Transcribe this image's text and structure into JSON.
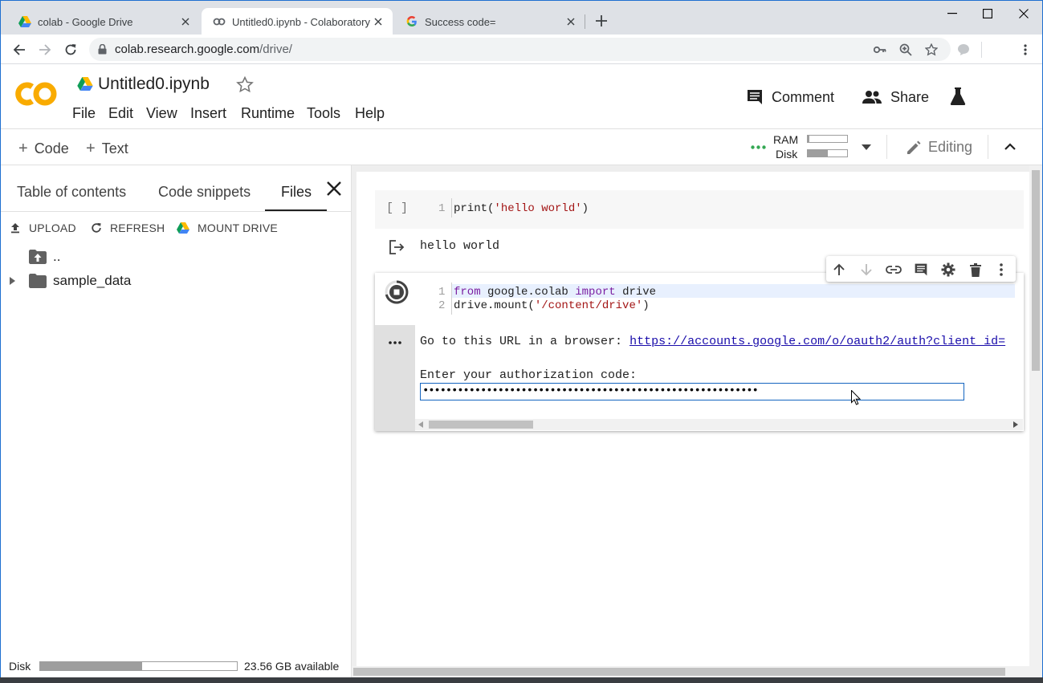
{
  "browser": {
    "tabs": [
      {
        "title": "colab - Google Drive"
      },
      {
        "title": "Untitled0.ipynb - Colaboratory"
      },
      {
        "title": "Success code="
      }
    ],
    "url_host": "colab.research.google.com",
    "url_path": "/drive/"
  },
  "header": {
    "logo_text": "CO",
    "notebook_title": "Untitled0.ipynb",
    "menus": [
      "File",
      "Edit",
      "View",
      "Insert",
      "Runtime",
      "Tools",
      "Help"
    ],
    "comment_label": "Comment",
    "share_label": "Share"
  },
  "toolbar": {
    "code_label": "Code",
    "text_label": "Text",
    "ram_label": "RAM",
    "disk_label": "Disk",
    "ram_fraction": 0.04,
    "disk_fraction": 0.5,
    "editing_label": "Editing"
  },
  "sidepanel": {
    "tabs": [
      "Table of contents",
      "Code snippets",
      "Files"
    ],
    "actions": {
      "upload": "UPLOAD",
      "refresh": "REFRESH",
      "mount": "MOUNT DRIVE"
    },
    "files": [
      "..",
      "sample_data"
    ],
    "disk_label": "Disk",
    "disk_available": "23.56 GB available",
    "disk_fraction": 0.52
  },
  "cells": {
    "cell1": {
      "bracket": "[ ]",
      "line_no": "1",
      "code_fn": "print",
      "code_str": "'hello world'",
      "output": "hello world"
    },
    "cell2": {
      "line_nos": [
        "1",
        "2"
      ],
      "line1_kw1": "from",
      "line1_mod": "google.colab",
      "line1_kw2": "import",
      "line1_name": "drive",
      "line2_call": "drive.mount(",
      "line2_str": "'/content/drive'",
      "line2_end": ")",
      "output_prompt": "Go to this URL in a browser:",
      "output_url": "https://accounts.google.com/o/oauth2/auth?client_id=",
      "auth_prompt": "Enter your authorization code:",
      "auth_value": "••••••••••••••••••••••••••••••••••••••••••••••••••••••••••"
    }
  },
  "colors": {
    "accent": "#1e6fd0",
    "logo_orange": "#f9ab00",
    "link": "#1a0dab",
    "keyword": "#7b1fa2",
    "string": "#a31515"
  }
}
